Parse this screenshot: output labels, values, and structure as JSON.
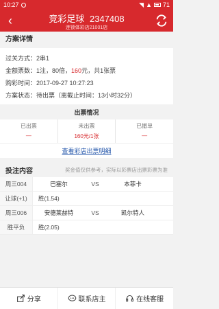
{
  "status": {
    "time": "10:27",
    "battery": "71"
  },
  "header": {
    "title_game": "竞彩足球",
    "title_id": "2347408",
    "subtitle": "连锁体彩店21001店"
  },
  "detail": {
    "section_title": "方案详情",
    "rows": [
      {
        "label": "过关方式：",
        "value": "2串1"
      },
      {
        "label": "金额票数：",
        "value_a": "1注，80倍，",
        "value_red": "160",
        "value_b": "元，共1张票"
      },
      {
        "label": "购彩时间：",
        "value": "2017-09-27 10:27:23"
      },
      {
        "label": "方案状态：",
        "value": "待出票（离截止时间：13小时32分）"
      }
    ]
  },
  "ticketing": {
    "title": "出票情况",
    "cells": [
      {
        "label": "已出票",
        "value": "—"
      },
      {
        "label": "未出票",
        "value": "160元/1张"
      },
      {
        "label": "已撤单",
        "value": "—"
      }
    ],
    "link": "查看彩店出票明细"
  },
  "bets": {
    "title": "投注内容",
    "note": "奖金值仅供参考，实际以彩票店出票彩票为准",
    "rows": [
      {
        "key": "周三004",
        "home": "巴塞尔",
        "vs": "VS",
        "away": "本菲卡"
      },
      {
        "key": "让球(+1)",
        "odds": "胜(1.54)"
      },
      {
        "key": "周三006",
        "home": "安德莱赫特",
        "vs": "VS",
        "away": "凯尔特人"
      },
      {
        "key": "胜平负",
        "odds": "胜(2.05)"
      }
    ]
  },
  "bottom": {
    "share": "分享",
    "contact": "联系店主",
    "service": "在线客服"
  }
}
